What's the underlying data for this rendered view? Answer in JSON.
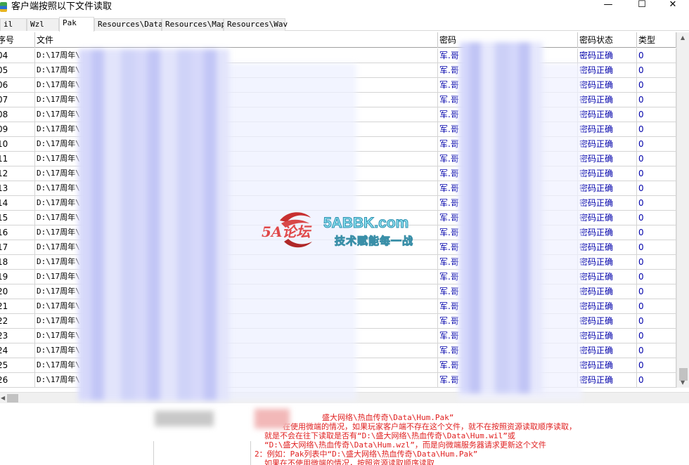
{
  "window": {
    "title": "客户端按照以下文件读取",
    "min_glyph": "—",
    "max_glyph": "☐",
    "close_glyph": "✕"
  },
  "tabs": [
    {
      "label": "il"
    },
    {
      "label": "Wzl"
    },
    {
      "label": "Pak",
      "active": true
    },
    {
      "label": "Resources\\Data"
    },
    {
      "label": "Resources\\Map"
    },
    {
      "label": "Resources\\Wav"
    }
  ],
  "columns": [
    "序号",
    "文件",
    "密码",
    "密码状态",
    "类型"
  ],
  "rows": [
    {
      "no": "04",
      "file": "D:\\17周年\\",
      "pwd": "军.哥",
      "status": "密码正确",
      "type": "0"
    },
    {
      "no": "05",
      "file": "D:\\17周年\\",
      "pwd": "军.哥",
      "status": "密码正确",
      "type": "0"
    },
    {
      "no": "06",
      "file": "D:\\17周年\\",
      "pwd": "军.哥",
      "status": "密码正确",
      "type": "0"
    },
    {
      "no": "07",
      "file": "D:\\17周年\\",
      "pwd": "军.哥",
      "status": "密码正确",
      "type": "0"
    },
    {
      "no": "08",
      "file": "D:\\17周年\\",
      "pwd": "军.哥",
      "status": "密码正确",
      "type": "0"
    },
    {
      "no": "09",
      "file": "D:\\17周年\\",
      "pwd": "军.哥",
      "status": "密码正确",
      "type": "0"
    },
    {
      "no": "10",
      "file": "D:\\17周年\\",
      "pwd": "军.哥",
      "status": "密码正确",
      "type": "0"
    },
    {
      "no": "11",
      "file": "D:\\17周年\\",
      "pwd": "军.哥",
      "status": "密码正确",
      "type": "0"
    },
    {
      "no": "12",
      "file": "D:\\17周年\\",
      "pwd": "军.哥",
      "status": "密码正确",
      "type": "0"
    },
    {
      "no": "13",
      "file": "D:\\17周年\\",
      "pwd": "军.哥",
      "status": "密码正确",
      "type": "0"
    },
    {
      "no": "14",
      "file": "D:\\17周年\\",
      "pwd": "军.哥",
      "status": "密码正确",
      "type": "0"
    },
    {
      "no": "15",
      "file": "D:\\17周年\\",
      "pwd": "军.哥",
      "status": "密码正确",
      "type": "0"
    },
    {
      "no": "16",
      "file": "D:\\17周年\\",
      "pwd": "军.哥",
      "status": "密码正确",
      "type": "0"
    },
    {
      "no": "17",
      "file": "D:\\17周年\\",
      "pwd": "军.哥",
      "status": "密码正确",
      "type": "0"
    },
    {
      "no": "18",
      "file": "D:\\17周年\\",
      "pwd": "军.哥",
      "status": "密码正确",
      "type": "0"
    },
    {
      "no": "19",
      "file": "D:\\17周年\\",
      "pwd": "军.哥",
      "status": "密码正确",
      "type": "0"
    },
    {
      "no": "20",
      "file": "D:\\17周年\\",
      "pwd": "军.哥",
      "status": "密码正确",
      "type": "0"
    },
    {
      "no": "21",
      "file": "D:\\17周年\\",
      "pwd": "军.哥",
      "status": "密码正确",
      "type": "0"
    },
    {
      "no": "22",
      "file": "D:\\17周年\\",
      "pwd": "军.哥",
      "status": "密码正确",
      "type": "0"
    },
    {
      "no": "23",
      "file": "D:\\17周年\\",
      "pwd": "军.哥",
      "status": "密码正确",
      "type": "0"
    },
    {
      "no": "24",
      "file": "D:\\17周年\\",
      "pwd": "军.哥",
      "status": "密码正确",
      "type": "0"
    },
    {
      "no": "25",
      "file": "D:\\17周年\\",
      "pwd": "军.哥",
      "status": "密码正确",
      "type": "0"
    },
    {
      "no": "26",
      "file": "D:\\17周年\\",
      "pwd": "军.哥",
      "status": "密码正确",
      "type": "0"
    }
  ],
  "info_lines": [
    "盛大网络\\热血传奇\\Data\\Hum.Pak”",
    "在使用微端的情况，如果玩家客户端不存在这个文件，就不在按照资源读取顺序读取，",
    "就是不会在往下读取是否有“D:\\盛大网络\\热血传奇\\Data\\Hum.wil”或",
    "“D:\\盛大网络\\热血传奇\\Data\\Hum.wzl”，而是向微端服务器请求更新这个文件",
    "2：例如：Pak列表中“D:\\盛大网络\\热血传奇\\Data\\Hum.Pak”",
    "如果在不使用微端的情况，按照资源读取顺序读取"
  ],
  "watermark": {
    "brand": "5A论坛",
    "domain": "5ABBK.com",
    "slogan": "技术赋能每一战"
  },
  "colors": {
    "status_text": "#0000aa",
    "info_text": "#e02020"
  }
}
